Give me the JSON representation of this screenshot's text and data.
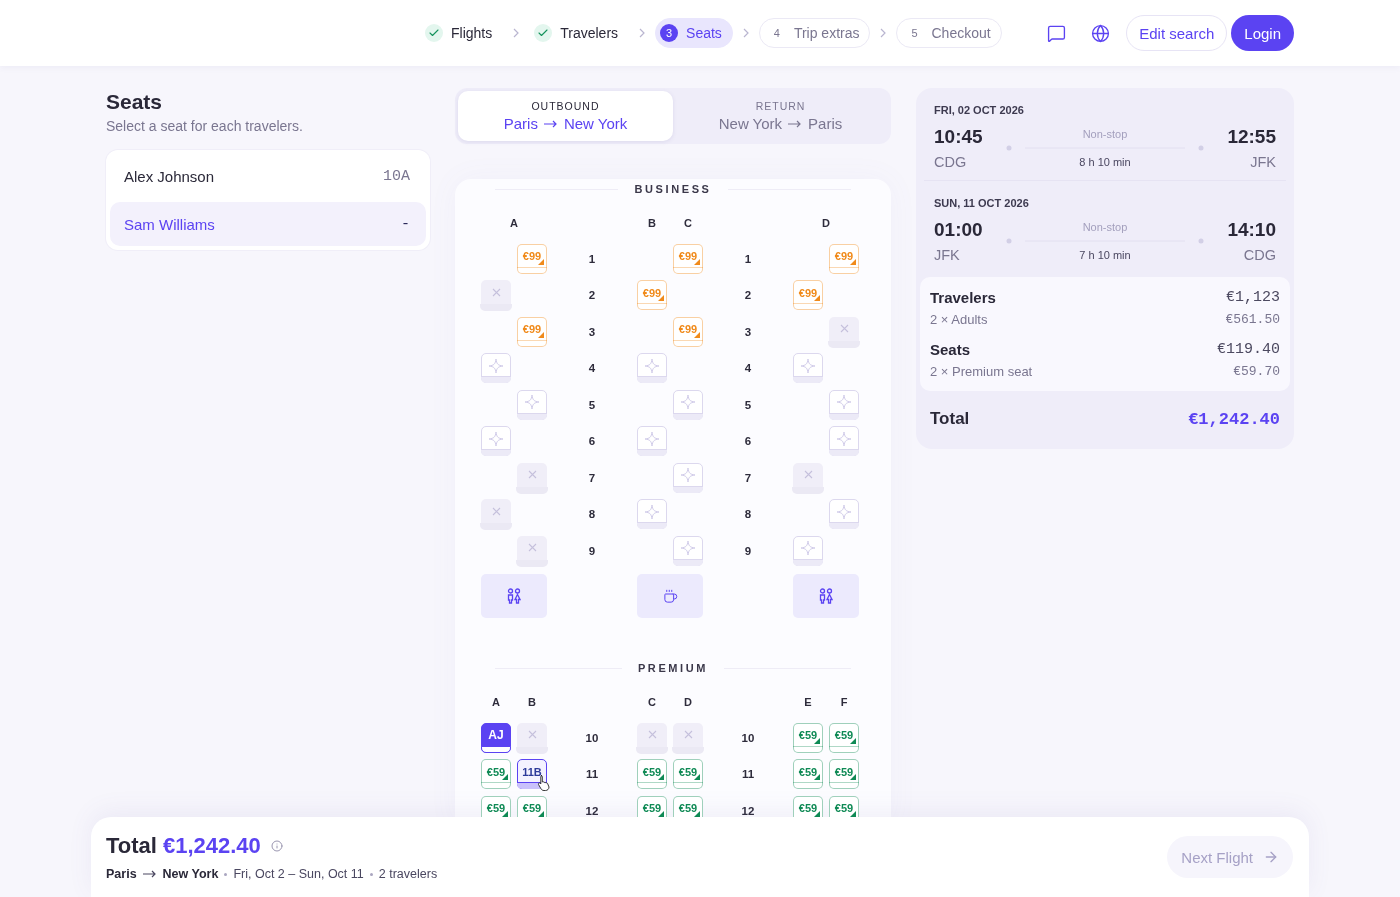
{
  "header": {
    "steps": [
      {
        "label": "Flights",
        "done": true,
        "selected": false
      },
      {
        "label": "Travelers",
        "done": true,
        "selected": false
      },
      {
        "number": "3",
        "label": "Seats",
        "done": false,
        "selected": true
      },
      {
        "number": "4",
        "label": "Trip extras",
        "done": false,
        "selected": false
      },
      {
        "number": "5",
        "label": "Checkout",
        "done": false,
        "selected": false
      }
    ],
    "edit_search": "Edit search",
    "login": "Login"
  },
  "travelers_panel": {
    "title": "Seats",
    "subtitle": "Select a seat for each travelers.",
    "travelers": [
      {
        "name": "Alex Johnson",
        "seat": "10A",
        "selected": false
      },
      {
        "name": "Sam Williams",
        "seat": "-",
        "selected": true
      }
    ]
  },
  "flight_tabs": [
    {
      "label": "OUTBOUND",
      "from": "Paris",
      "to": "New York",
      "selected": true
    },
    {
      "label": "RETURN",
      "from": "New York",
      "to": "Paris",
      "selected": false
    }
  ],
  "cabins": [
    {
      "title": "BUSINESS",
      "color": "#f08a1a",
      "groups": [
        [
          {
            "label": "A",
            "kind": "staggered"
          }
        ],
        [
          {
            "label": "B",
            "kind": "single"
          },
          {
            "label": "C",
            "kind": "single"
          }
        ],
        [
          {
            "label": "D",
            "kind": "staggered"
          }
        ]
      ],
      "rows": [
        {
          "numbers": [
            "1",
            "1"
          ],
          "seats": [
            {
              "kind": "empty"
            },
            {
              "kind": "paid",
              "label": "€99"
            },
            {
              "kind": "empty"
            },
            {
              "kind": "paid",
              "label": "€99"
            },
            {
              "kind": "empty"
            },
            {
              "kind": "paid",
              "label": "€99"
            }
          ]
        },
        {
          "numbers": [
            "2",
            "2"
          ],
          "seats": [
            {
              "kind": "taken"
            },
            {
              "kind": "empty"
            },
            {
              "kind": "paid",
              "label": "€99"
            },
            {
              "kind": "empty"
            },
            {
              "kind": "paid",
              "label": "€99"
            },
            {
              "kind": "empty"
            }
          ]
        },
        {
          "numbers": [
            "3",
            "3"
          ],
          "seats": [
            {
              "kind": "empty"
            },
            {
              "kind": "paid",
              "label": "€99"
            },
            {
              "kind": "empty"
            },
            {
              "kind": "paid",
              "label": "€99"
            },
            {
              "kind": "empty"
            },
            {
              "kind": "taken"
            }
          ]
        },
        {
          "numbers": [
            "4",
            "4"
          ],
          "seats": [
            {
              "kind": "free"
            },
            {
              "kind": "empty"
            },
            {
              "kind": "free"
            },
            {
              "kind": "empty"
            },
            {
              "kind": "free"
            },
            {
              "kind": "empty"
            }
          ]
        },
        {
          "numbers": [
            "5",
            "5"
          ],
          "seats": [
            {
              "kind": "empty"
            },
            {
              "kind": "free"
            },
            {
              "kind": "empty"
            },
            {
              "kind": "free"
            },
            {
              "kind": "empty"
            },
            {
              "kind": "free"
            }
          ]
        },
        {
          "numbers": [
            "6",
            "6"
          ],
          "seats": [
            {
              "kind": "free"
            },
            {
              "kind": "empty"
            },
            {
              "kind": "free"
            },
            {
              "kind": "empty"
            },
            {
              "kind": "empty"
            },
            {
              "kind": "free"
            }
          ]
        },
        {
          "numbers": [
            "7",
            "7"
          ],
          "seats": [
            {
              "kind": "empty"
            },
            {
              "kind": "taken"
            },
            {
              "kind": "empty"
            },
            {
              "kind": "free"
            },
            {
              "kind": "taken"
            },
            {
              "kind": "empty"
            }
          ]
        },
        {
          "numbers": [
            "8",
            "8"
          ],
          "seats": [
            {
              "kind": "taken"
            },
            {
              "kind": "empty"
            },
            {
              "kind": "free"
            },
            {
              "kind": "empty"
            },
            {
              "kind": "empty"
            },
            {
              "kind": "free"
            }
          ]
        },
        {
          "numbers": [
            "9",
            "9"
          ],
          "seats": [
            {
              "kind": "empty"
            },
            {
              "kind": "taken"
            },
            {
              "kind": "empty"
            },
            {
              "kind": "free"
            },
            {
              "kind": "free"
            },
            {
              "kind": "empty"
            }
          ]
        }
      ],
      "facilities": [
        {
          "kind": "restroom"
        },
        {
          "kind": "galley"
        },
        {
          "kind": "restroom"
        }
      ]
    },
    {
      "title": "PREMIUM",
      "color": "#0f8a55",
      "groups": [
        [
          {
            "label": "A",
            "kind": "single"
          },
          {
            "label": "B",
            "kind": "single"
          }
        ],
        [
          {
            "label": "C",
            "kind": "single"
          },
          {
            "label": "D",
            "kind": "single"
          }
        ],
        [
          {
            "label": "E",
            "kind": "single"
          },
          {
            "label": "F",
            "kind": "single"
          }
        ]
      ],
      "rows": [
        {
          "numbers": [
            "10",
            "10"
          ],
          "seats": [
            {
              "kind": "traveler",
              "label": "AJ"
            },
            {
              "kind": "taken"
            },
            {
              "kind": "taken"
            },
            {
              "kind": "taken"
            },
            {
              "kind": "paid",
              "label": "€59"
            },
            {
              "kind": "paid",
              "label": "€59"
            }
          ]
        },
        {
          "numbers": [
            "11",
            "11"
          ],
          "seats": [
            {
              "kind": "paid",
              "label": "€59"
            },
            {
              "kind": "picked",
              "label": "11B"
            },
            {
              "kind": "paid",
              "label": "€59"
            },
            {
              "kind": "paid",
              "label": "€59"
            },
            {
              "kind": "paid",
              "label": "€59"
            },
            {
              "kind": "paid",
              "label": "€59"
            }
          ]
        },
        {
          "numbers": [
            "12",
            "12"
          ],
          "seats": [
            {
              "kind": "paid",
              "label": "€59"
            },
            {
              "kind": "paid",
              "label": "€59"
            },
            {
              "kind": "paid",
              "label": "€59"
            },
            {
              "kind": "paid",
              "label": "€59"
            },
            {
              "kind": "paid",
              "label": "€59"
            },
            {
              "kind": "paid",
              "label": "€59"
            }
          ]
        }
      ]
    }
  ],
  "itinerary": {
    "legs": [
      {
        "date": "FRI, 02 OCT 2026",
        "depart_time": "10:45",
        "depart_airport": "CDG",
        "stops": "Non-stop",
        "duration": "8 h 10 min",
        "arrive_time": "12:55",
        "arrive_airport": "JFK"
      },
      {
        "date": "SUN, 11 OCT 2026",
        "depart_time": "01:00",
        "depart_airport": "JFK",
        "stops": "Non-stop",
        "duration": "7 h 10 min",
        "arrive_time": "14:10",
        "arrive_airport": "CDG"
      }
    ],
    "lines": [
      {
        "label": "Travelers",
        "amount": "€1,123",
        "detail": "2 × Adults",
        "unit": "€561.50"
      },
      {
        "label": "Seats",
        "amount": "€119.40",
        "detail": "2 × Premium seat",
        "unit": "€59.70"
      }
    ],
    "total_label": "Total",
    "total": "€1,242.40"
  },
  "footer": {
    "total_label": "Total",
    "total": "€1,242.40",
    "from": "Paris",
    "to": "New York",
    "dates": "Fri, Oct 2 – Sun, Oct 11",
    "travelers": "2 travelers",
    "next": {
      "label": "Next Flight",
      "disabled": true
    }
  }
}
